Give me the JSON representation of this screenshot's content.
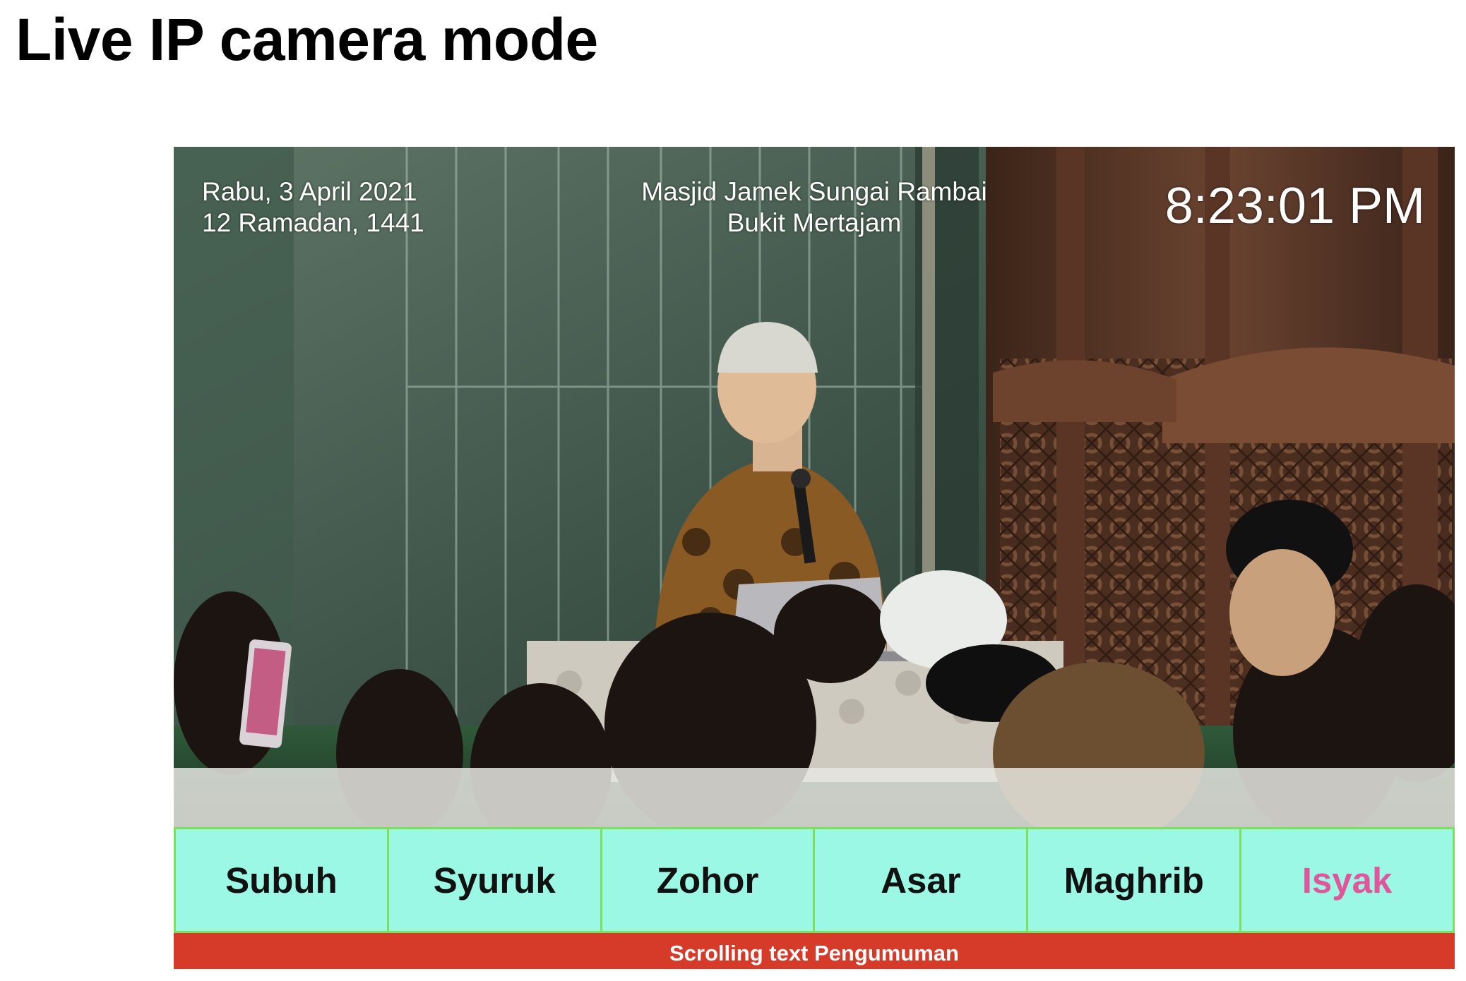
{
  "page": {
    "title": "Live IP camera mode"
  },
  "overlay": {
    "date_gregorian": "Rabu, 3 April 2021",
    "date_hijri": "12 Ramadan, 1441",
    "mosque_name": "Masjid Jamek Sungai Rambai",
    "mosque_location": "Bukit Mertajam",
    "clock": "8:23:01 PM"
  },
  "prayer_times": {
    "items": [
      {
        "label": "Subuh"
      },
      {
        "label": "Syuruk"
      },
      {
        "label": "Zohor"
      },
      {
        "label": "Asar"
      },
      {
        "label": "Maghrib"
      },
      {
        "label": "Isyak"
      }
    ],
    "active_index": 5
  },
  "ticker": {
    "text": "Scrolling text Pengumuman"
  },
  "colors": {
    "prayer_cell_bg": "#9bf8e4",
    "prayer_cell_border": "#7ddf5c",
    "active_prayer_text": "#e0559c",
    "ticker_bg": "#d63b2a"
  }
}
